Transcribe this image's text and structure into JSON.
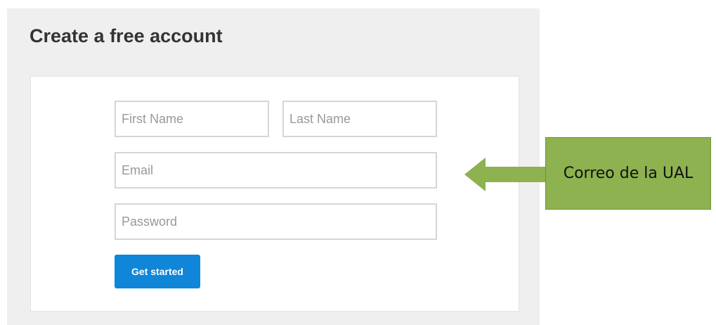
{
  "form": {
    "title": "Create a free account",
    "first_name_placeholder": "First Name",
    "last_name_placeholder": "Last Name",
    "email_placeholder": "Email",
    "password_placeholder": "Password",
    "submit_label": "Get started"
  },
  "annotation": {
    "text": "Correo de la UAL",
    "arrow_icon": "arrow-left-icon",
    "color": "#8db24f"
  },
  "colors": {
    "button": "#0f86d8",
    "panel_background": "#efefef"
  }
}
